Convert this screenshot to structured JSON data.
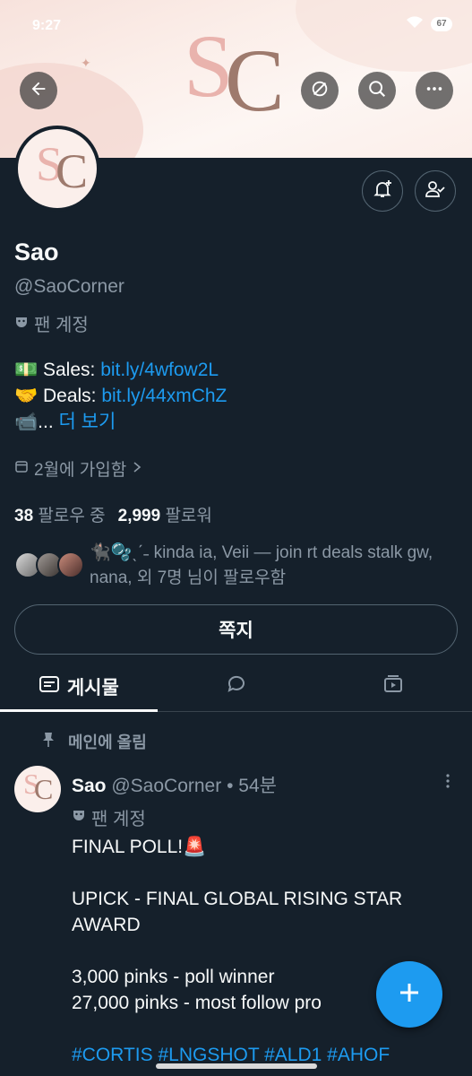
{
  "status_bar": {
    "time": "9:27",
    "battery": "67"
  },
  "colors": {
    "background": "#15202b",
    "accent": "#1d9bf0",
    "muted": "#8b98a5",
    "border": "#536471"
  },
  "banner": {
    "logo_letters": [
      "S",
      "C"
    ],
    "buttons": {
      "back_icon": "arrow-left-icon",
      "hide_icon": "eye-slash-icon",
      "search_icon": "search-icon",
      "more_icon": "more-horizontal-icon"
    }
  },
  "profile": {
    "avatar_letters": [
      "S",
      "C"
    ],
    "name": "Sao",
    "handle": "@SaoCorner",
    "fan_badge_icon": "mask-icon",
    "fan_badge": "팬 계정",
    "bio": {
      "line1_prefix": "💵 Sales: ",
      "line1_link": "bit.ly/4wfow2L",
      "line2_prefix": "🤝 Deals: ",
      "line2_link": "bit.ly/44xmChZ",
      "line3_prefix": "📹... ",
      "line3_link": "더 보기"
    },
    "joined": "2월에 가입함",
    "following_count": "38",
    "following_label": "팔로우 중",
    "followers_count": "2,999",
    "followers_label": "팔로워",
    "followed_by": "🐈‍⬛🫧ˎˊ˗ kinda ia, Veii — join rt deals stalk gw, nana, 외 7명 님이 팔로우함",
    "dm_button": "쪽지",
    "notification_icon": "bell-plus-icon",
    "follow_icon": "user-check-icon"
  },
  "tabs": [
    {
      "label": "게시물",
      "icon": "posts-icon",
      "active": true
    },
    {
      "label": "",
      "icon": "reply-bubble-icon",
      "active": false
    },
    {
      "label": "",
      "icon": "media-play-icon",
      "active": false
    }
  ],
  "pinned_post": {
    "pinned_label": "메인에 올림",
    "author_name": "Sao",
    "author_handle": "@SaoCorner",
    "time": "• 54분",
    "fan_badge": "팬 계정",
    "lines": [
      "FINAL POLL!🚨",
      "",
      "UPICK - FINAL GLOBAL RISING STAR",
      "AWARD",
      "",
      "3,000 pinks - poll winner",
      "27,000 pinks - most follow pro"
    ],
    "hashtags": "#CORTIS #LNGSHOT #ALD1 #AHOF"
  },
  "fab": {
    "icon": "plus-icon"
  }
}
